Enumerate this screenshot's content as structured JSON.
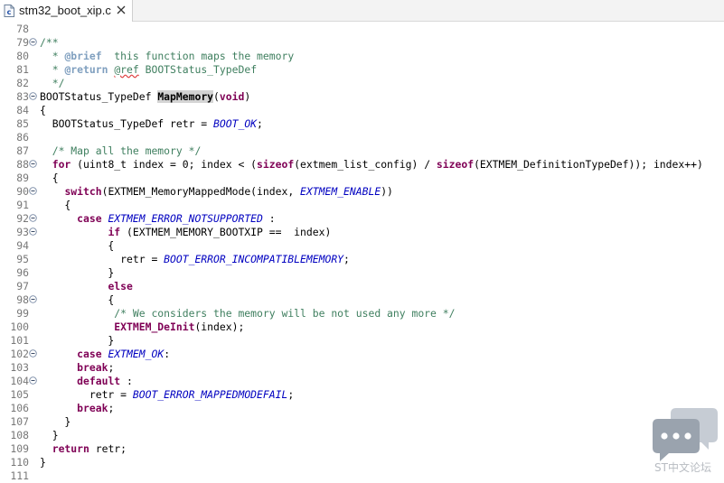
{
  "tab": {
    "title": "stm32_boot_xip.c"
  },
  "watermark": {
    "text": "ST中文论坛"
  },
  "lines": [
    {
      "n": "78",
      "fold": false,
      "segs": []
    },
    {
      "n": "79",
      "fold": true,
      "segs": [
        [
          "cm",
          "/**"
        ]
      ]
    },
    {
      "n": "80",
      "fold": false,
      "segs": [
        [
          "cm",
          "  * "
        ],
        [
          "tag",
          "@brief"
        ],
        [
          "cm",
          "  this function maps the memory"
        ]
      ]
    },
    {
      "n": "81",
      "fold": false,
      "segs": [
        [
          "cm",
          "  * "
        ],
        [
          "tag",
          "@return"
        ],
        [
          "cm",
          " "
        ],
        [
          "cmsq",
          "@ref"
        ],
        [
          "cm",
          " BOOTStatus_TypeDef"
        ]
      ]
    },
    {
      "n": "82",
      "fold": false,
      "segs": [
        [
          "cm",
          "  */"
        ]
      ]
    },
    {
      "n": "83",
      "fold": true,
      "segs": [
        [
          "",
          "BOOTStatus_TypeDef "
        ],
        [
          "hl",
          "MapMemory"
        ],
        [
          "",
          "("
        ],
        [
          "kw",
          "void"
        ],
        [
          "",
          ")"
        ]
      ]
    },
    {
      "n": "84",
      "fold": false,
      "segs": [
        [
          "",
          "{"
        ]
      ]
    },
    {
      "n": "85",
      "fold": false,
      "segs": [
        [
          "",
          "  BOOTStatus_TypeDef retr = "
        ],
        [
          "en",
          "BOOT_OK"
        ],
        [
          "",
          ";"
        ]
      ]
    },
    {
      "n": "86",
      "fold": false,
      "segs": []
    },
    {
      "n": "87",
      "fold": false,
      "segs": [
        [
          "cm",
          "  /* Map all the memory */"
        ]
      ]
    },
    {
      "n": "88",
      "fold": true,
      "segs": [
        [
          "",
          "  "
        ],
        [
          "kw",
          "for"
        ],
        [
          "",
          " (uint8_t index = 0; index < ("
        ],
        [
          "kw",
          "sizeof"
        ],
        [
          "",
          "(extmem_list_config) / "
        ],
        [
          "kw",
          "sizeof"
        ],
        [
          "",
          "(EXTMEM_DefinitionTypeDef)); index++)"
        ]
      ]
    },
    {
      "n": "89",
      "fold": false,
      "segs": [
        [
          "",
          "  {"
        ]
      ]
    },
    {
      "n": "90",
      "fold": true,
      "segs": [
        [
          "",
          "    "
        ],
        [
          "kw",
          "switch"
        ],
        [
          "",
          "(EXTMEM_MemoryMappedMode(index, "
        ],
        [
          "en",
          "EXTMEM_ENABLE"
        ],
        [
          "",
          "))"
        ]
      ]
    },
    {
      "n": "91",
      "fold": false,
      "segs": [
        [
          "",
          "    {"
        ]
      ]
    },
    {
      "n": "92",
      "fold": true,
      "segs": [
        [
          "",
          "      "
        ],
        [
          "kw",
          "case"
        ],
        [
          "",
          " "
        ],
        [
          "en",
          "EXTMEM_ERROR_NOTSUPPORTED"
        ],
        [
          "",
          " :"
        ]
      ]
    },
    {
      "n": "93",
      "fold": true,
      "segs": [
        [
          "",
          "           "
        ],
        [
          "kw",
          "if"
        ],
        [
          "",
          " (EXTMEM_MEMORY_BOOTXIP ==  index)"
        ]
      ]
    },
    {
      "n": "94",
      "fold": false,
      "segs": [
        [
          "",
          "           {"
        ]
      ]
    },
    {
      "n": "95",
      "fold": false,
      "segs": [
        [
          "",
          "             retr = "
        ],
        [
          "en",
          "BOOT_ERROR_INCOMPATIBLEMEMORY"
        ],
        [
          "",
          ";"
        ]
      ]
    },
    {
      "n": "96",
      "fold": false,
      "segs": [
        [
          "",
          "           }"
        ]
      ]
    },
    {
      "n": "97",
      "fold": false,
      "segs": [
        [
          "",
          "           "
        ],
        [
          "kw",
          "else"
        ]
      ]
    },
    {
      "n": "98",
      "fold": true,
      "segs": [
        [
          "",
          "           {"
        ]
      ]
    },
    {
      "n": "99",
      "fold": false,
      "segs": [
        [
          "cm",
          "            /* We considers the memory will be not used any more */"
        ]
      ]
    },
    {
      "n": "100",
      "fold": false,
      "segs": [
        [
          "",
          "            "
        ],
        [
          "kw",
          "EXTMEM_DeInit"
        ],
        [
          "",
          "(index);"
        ]
      ]
    },
    {
      "n": "101",
      "fold": false,
      "segs": [
        [
          "",
          "           }"
        ]
      ]
    },
    {
      "n": "102",
      "fold": true,
      "segs": [
        [
          "",
          "      "
        ],
        [
          "kw",
          "case"
        ],
        [
          "",
          " "
        ],
        [
          "en",
          "EXTMEM_OK"
        ],
        [
          "",
          ":"
        ]
      ]
    },
    {
      "n": "103",
      "fold": false,
      "segs": [
        [
          "",
          "      "
        ],
        [
          "kw",
          "break"
        ],
        [
          "",
          ";"
        ]
      ]
    },
    {
      "n": "104",
      "fold": true,
      "segs": [
        [
          "",
          "      "
        ],
        [
          "kw",
          "default"
        ],
        [
          "",
          " :"
        ]
      ]
    },
    {
      "n": "105",
      "fold": false,
      "segs": [
        [
          "",
          "        retr = "
        ],
        [
          "en",
          "BOOT_ERROR_MAPPEDMODEFAIL"
        ],
        [
          "",
          ";"
        ]
      ]
    },
    {
      "n": "106",
      "fold": false,
      "segs": [
        [
          "",
          "      "
        ],
        [
          "kw",
          "break"
        ],
        [
          "",
          ";"
        ]
      ]
    },
    {
      "n": "107",
      "fold": false,
      "segs": [
        [
          "",
          "    }"
        ]
      ]
    },
    {
      "n": "108",
      "fold": false,
      "segs": [
        [
          "",
          "  }"
        ]
      ]
    },
    {
      "n": "109",
      "fold": false,
      "segs": [
        [
          "",
          "  "
        ],
        [
          "kw",
          "return"
        ],
        [
          "",
          " retr;"
        ]
      ]
    },
    {
      "n": "110",
      "fold": false,
      "segs": [
        [
          "",
          "}"
        ]
      ]
    },
    {
      "n": "111",
      "fold": false,
      "segs": []
    }
  ]
}
